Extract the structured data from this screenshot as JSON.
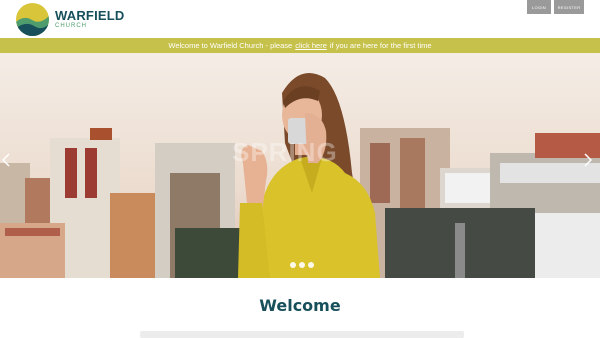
{
  "header": {
    "logo_name": "WARFIELD",
    "logo_sub": "CHURCH",
    "login_label": "LOGIN",
    "register_label": "REGISTER"
  },
  "announcement": {
    "text_before": "Welcome to Warfield Church - please",
    "link_text": "click here",
    "text_after": "if you are here for the first time"
  },
  "hero": {
    "slide_count": 3,
    "watermark": "SPRING",
    "prev_icon": "chevron-left-icon",
    "next_icon": "chevron-right-icon"
  },
  "welcome": {
    "title": "Welcome"
  },
  "colors": {
    "brand_dark": "#17505b",
    "brand_green": "#4f9c6d",
    "announce_bg": "#c6c14a",
    "button_gray": "#9a9a9a"
  }
}
